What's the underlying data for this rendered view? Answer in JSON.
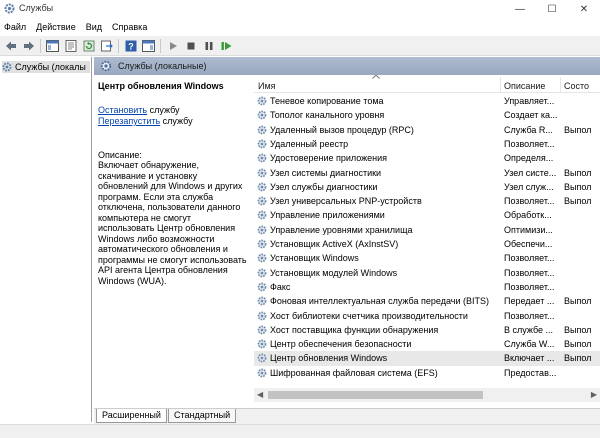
{
  "window": {
    "title": "Службы",
    "minimize": "—",
    "maximize": "☐",
    "close": "✕"
  },
  "menu": [
    "Файл",
    "Действие",
    "Вид",
    "Справка"
  ],
  "left_pane": {
    "item": "Службы (локалы"
  },
  "right_header": "Службы (локальные)",
  "detail": {
    "service_name": "Центр обновления Windows",
    "stop_link": "Остановить",
    "stop_suffix": " службу",
    "restart_link": "Перезапустить",
    "restart_suffix": " службу",
    "desc_label": "Описание:",
    "desc_text": "Включает обнаружение, скачивание и установку обновлений для Windows и других программ. Если эта служба отключена, пользователи данного компьютера не смогут использовать Центр обновления Windows либо возможности автоматического обновления и программы не смогут использовать API агента Центра обновления Windows (WUA)."
  },
  "columns": {
    "name": "Имя",
    "desc": "Описание",
    "status": "Состо"
  },
  "rows": [
    {
      "name": "Теневое копирование тома",
      "desc": "Управляет...",
      "status": ""
    },
    {
      "name": "Тополог канального уровня",
      "desc": "Создает ка...",
      "status": ""
    },
    {
      "name": "Удаленный вызов процедур (RPC)",
      "desc": "Служба R...",
      "status": "Выпол"
    },
    {
      "name": "Удаленный реестр",
      "desc": "Позволяет...",
      "status": ""
    },
    {
      "name": "Удостоверение приложения",
      "desc": "Определя...",
      "status": ""
    },
    {
      "name": "Узел системы диагностики",
      "desc": "Узел систе...",
      "status": "Выпол"
    },
    {
      "name": "Узел службы диагностики",
      "desc": "Узел служ...",
      "status": "Выпол"
    },
    {
      "name": "Узел универсальных PNP-устройств",
      "desc": "Позволяет...",
      "status": "Выпол"
    },
    {
      "name": "Управление приложениями",
      "desc": "Обработк...",
      "status": ""
    },
    {
      "name": "Управление уровнями хранилища",
      "desc": "Оптимизи...",
      "status": ""
    },
    {
      "name": "Установщик ActiveX (AxInstSV)",
      "desc": "Обеспечи...",
      "status": ""
    },
    {
      "name": "Установщик Windows",
      "desc": "Позволяет...",
      "status": ""
    },
    {
      "name": "Установщик модулей Windows",
      "desc": "Позволяет...",
      "status": ""
    },
    {
      "name": "Факс",
      "desc": "Позволяет...",
      "status": ""
    },
    {
      "name": "Фоновая интеллектуальная служба передачи (BITS)",
      "desc": "Передает ...",
      "status": "Выпол"
    },
    {
      "name": "Хост библиотеки счетчика производительности",
      "desc": "Позволяет...",
      "status": ""
    },
    {
      "name": "Хост поставщика функции обнаружения",
      "desc": "В службе ...",
      "status": "Выпол"
    },
    {
      "name": "Центр обеспечения безопасности",
      "desc": "Служба W...",
      "status": "Выпол"
    },
    {
      "name": "Центр обновления Windows",
      "desc": "Включает ...",
      "status": "Выпол"
    },
    {
      "name": "Шифрованная файловая система (EFS)",
      "desc": "Предостав...",
      "status": ""
    }
  ],
  "selected_row": 18,
  "tabs": [
    "Расширенный",
    "Стандартный"
  ],
  "colors": {
    "header_bg": "#a3b2c9",
    "link": "#0645ad",
    "selection": "#e8e8e8"
  }
}
